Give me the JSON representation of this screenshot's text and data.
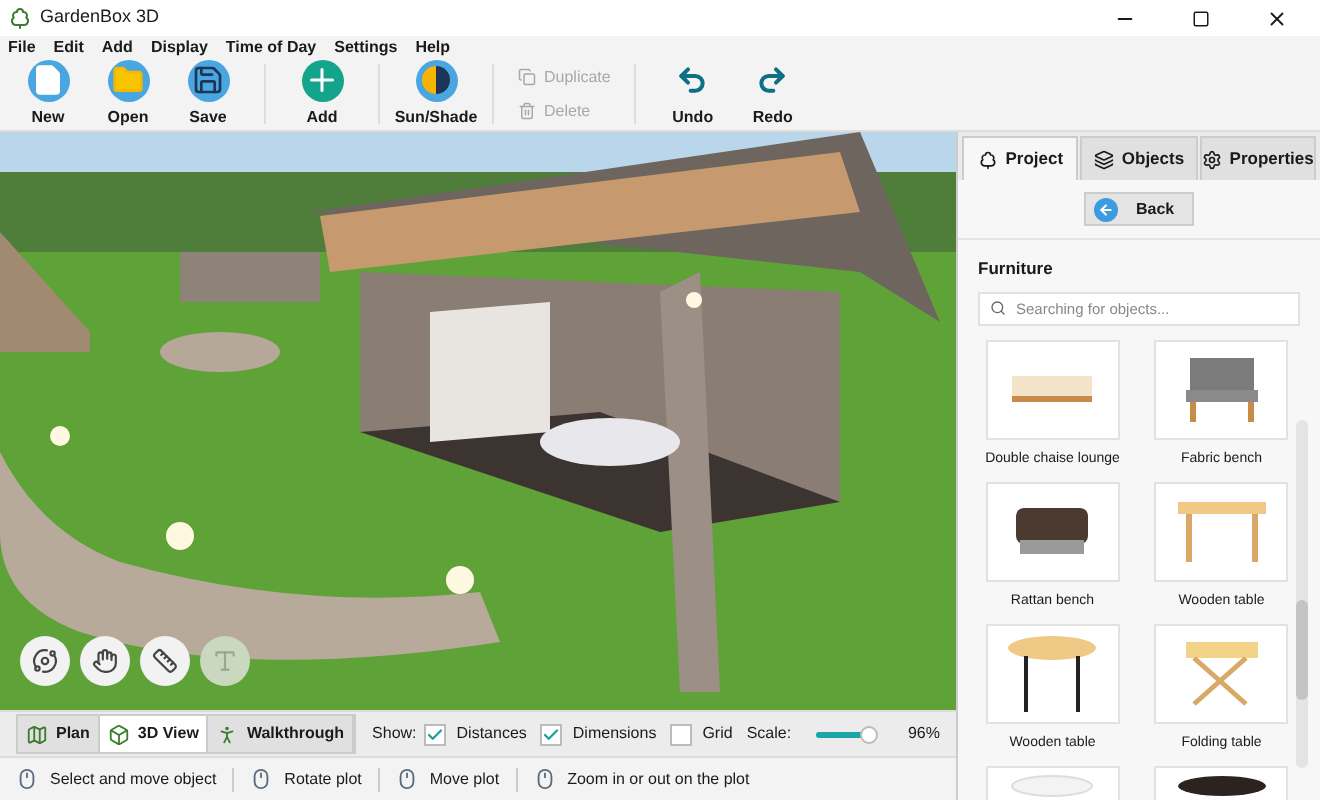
{
  "window": {
    "title": "GardenBox 3D"
  },
  "menu": [
    "File",
    "Edit",
    "Add",
    "Display",
    "Time of Day",
    "Settings",
    "Help"
  ],
  "toolbar": [
    {
      "kind": "big",
      "label": "New",
      "disabled": false
    },
    {
      "kind": "big",
      "label": "Open",
      "disabled": false
    },
    {
      "kind": "big",
      "label": "Save",
      "disabled": false
    },
    {
      "kind": "sep"
    },
    {
      "kind": "big",
      "label": "Add",
      "disabled": false
    },
    {
      "kind": "sep"
    },
    {
      "kind": "big",
      "label": "Sun/Shade",
      "disabled": false
    },
    {
      "kind": "sep"
    },
    {
      "kind": "pair",
      "items": [
        {
          "label": "Duplicate",
          "disabled": true
        },
        {
          "label": "Delete",
          "disabled": true
        }
      ]
    },
    {
      "kind": "sep"
    },
    {
      "kind": "big",
      "label": "Undo",
      "disabled": false
    },
    {
      "kind": "big",
      "label": "Redo",
      "disabled": false
    }
  ],
  "panel": {
    "tabs": [
      {
        "label": "Project",
        "selected": true
      },
      {
        "label": "Objects",
        "selected": false
      },
      {
        "label": "Properties",
        "selected": false
      }
    ],
    "back": "Back",
    "section": "Furniture",
    "search": {
      "placeholder": "Searching for objects..."
    },
    "objects": [
      {
        "name": "Double chaise lounge",
        "kind": "lounge"
      },
      {
        "name": "Fabric bench",
        "kind": "bench"
      },
      {
        "name": "Rattan bench",
        "kind": "rattan"
      },
      {
        "name": "Wooden table",
        "kind": "table"
      },
      {
        "name": "Wooden table",
        "kind": "round"
      },
      {
        "name": "Folding table",
        "kind": "folding"
      },
      {
        "kind": "white"
      },
      {
        "kind": "dark"
      }
    ]
  },
  "view_tools": [
    {
      "disabled": false
    },
    {
      "disabled": false
    },
    {
      "disabled": false
    },
    {
      "disabled": true
    }
  ],
  "view_modes": [
    {
      "label": "Plan",
      "selected": false
    },
    {
      "label": "3D View",
      "selected": true
    },
    {
      "label": "Walkthrough",
      "selected": false
    }
  ],
  "show": {
    "label": "Show:",
    "options": [
      {
        "label": "Distances",
        "checked": true
      },
      {
        "label": "Dimensions",
        "checked": true
      },
      {
        "label": "Grid",
        "checked": false
      }
    ]
  },
  "scale": {
    "label": "Scale:",
    "level": 0.96,
    "reading": "96%"
  },
  "status_bar": [
    "Select and move object",
    "Rotate plot",
    "Move plot",
    "Zoom in or out on the plot"
  ]
}
